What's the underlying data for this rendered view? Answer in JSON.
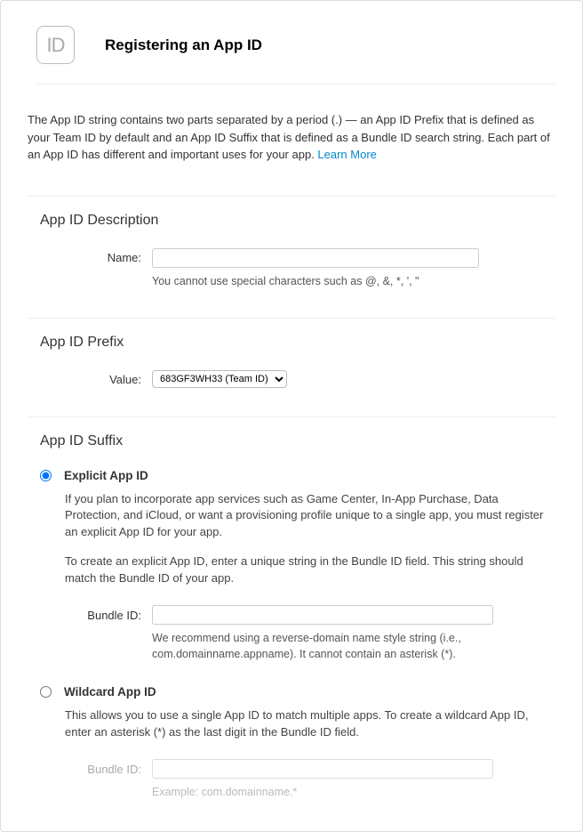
{
  "header": {
    "icon_text": "ID",
    "title": "Registering an App ID"
  },
  "intro": {
    "text": "The App ID string contains two parts separated by a period (.) — an App ID Prefix that is defined as your Team ID by default and an App ID Suffix that is defined as a Bundle ID search string. Each part of an App ID has different and important uses for your app. ",
    "link_text": "Learn More"
  },
  "description_section": {
    "title": "App ID Description",
    "name_label": "Name:",
    "name_value": "",
    "name_hint": "You cannot use special characters such as @, &, *, ', \""
  },
  "prefix_section": {
    "title": "App ID Prefix",
    "value_label": "Value:",
    "selected_option": "683GF3WH33 (Team ID)"
  },
  "suffix_section": {
    "title": "App ID Suffix",
    "explicit": {
      "label": "Explicit App ID",
      "para1": "If you plan to incorporate app services such as Game Center, In-App Purchase, Data Protection, and iCloud, or want a provisioning profile unique to a single app, you must register an explicit App ID for your app.",
      "para2": "To create an explicit App ID, enter a unique string in the Bundle ID field. This string should match the Bundle ID of your app.",
      "bundle_label": "Bundle ID:",
      "bundle_value": "",
      "bundle_hint": "We recommend using a reverse-domain name style string (i.e., com.domainname.appname). It cannot contain an asterisk (*)."
    },
    "wildcard": {
      "label": "Wildcard App ID",
      "para1": "This allows you to use a single App ID to match multiple apps. To create a wildcard App ID, enter an asterisk (*) as the last digit in the Bundle ID field.",
      "bundle_label": "Bundle ID:",
      "bundle_value": "",
      "bundle_hint": "Example: com.domainname.*"
    }
  }
}
